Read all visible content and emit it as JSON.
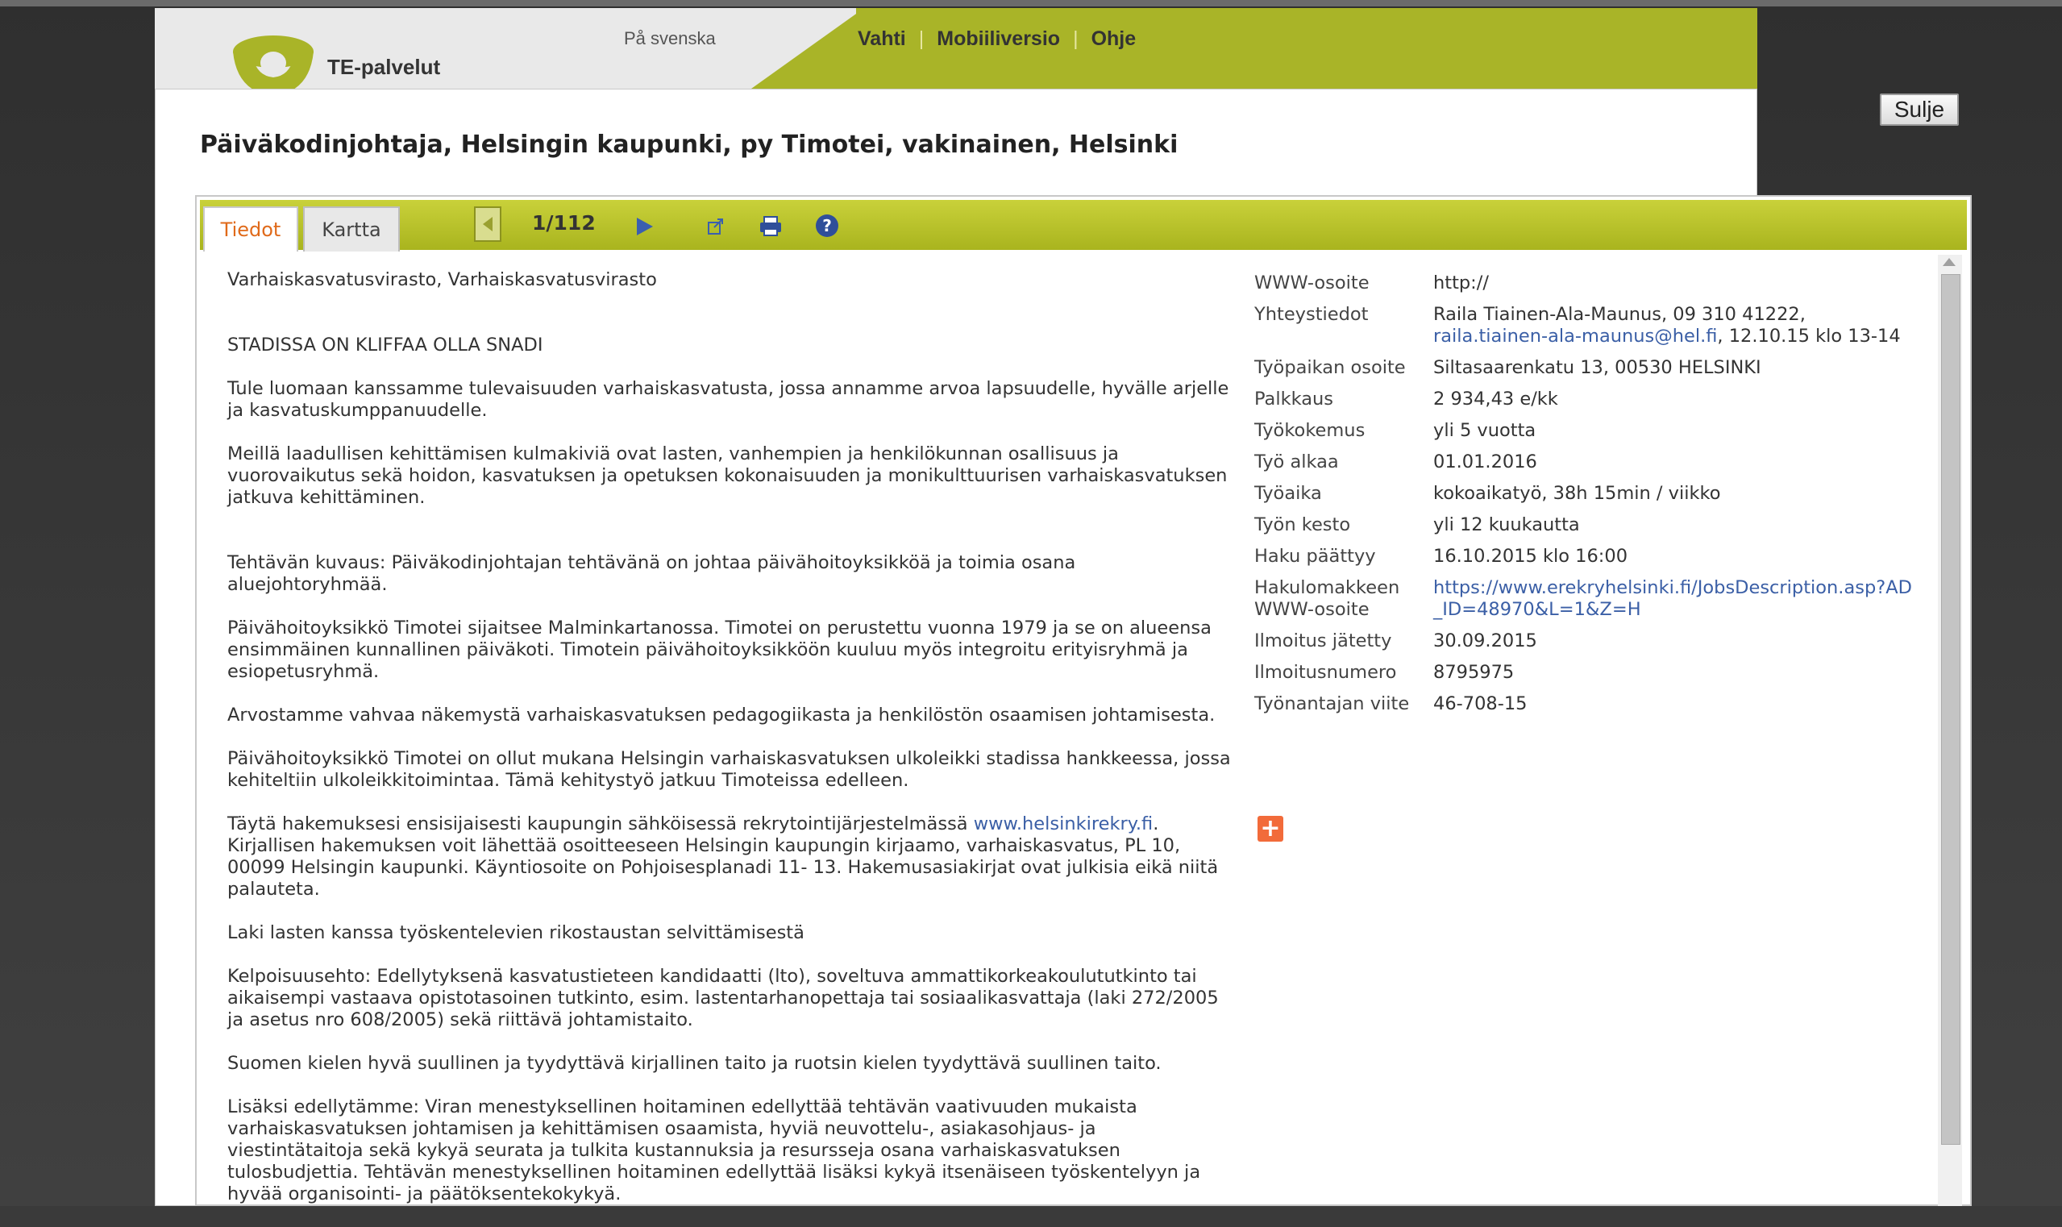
{
  "header": {
    "logo_text": "TE-palvelut",
    "language_link": "På svenska",
    "nav": [
      "Vahti",
      "Mobiiliversio",
      "Ohje"
    ]
  },
  "modal": {
    "close_label": "Sulje",
    "title": "Päiväkodinjohtaja, Helsingin kaupunki, py Timotei, vakinainen, Helsinki"
  },
  "tabs": {
    "info": "Tiedot",
    "map": "Kartta"
  },
  "pager": {
    "count": "1/112"
  },
  "icons": [
    "prev-arrow-icon",
    "next-arrow-icon",
    "external-link-icon",
    "print-icon",
    "help-icon",
    "add-icon"
  ],
  "colors": {
    "header_green": "#a9b428",
    "active_tab": "#e06a1a",
    "link": "#3b5fa6"
  },
  "content": {
    "employer": "Varhaiskasvatusvirasto, Varhaiskasvatusvirasto",
    "slogan": "STADISSA ON KLIFFAA OLLA SNADI",
    "p1": "Tule luomaan kanssamme tulevaisuuden varhaiskasvatusta, jossa annamme arvoa lapsuudelle, hyvälle arjelle ja kasvatuskumppanuudelle.",
    "p2": "Meillä laadullisen kehittämisen kulmakiviä ovat lasten, vanhempien ja henkilökunnan osallisuus ja vuorovaikutus sekä hoidon, kasvatuksen ja opetuksen kokonaisuuden ja monikulttuurisen varhaiskasvatuksen jatkuva kehittäminen.",
    "p3": "Tehtävän kuvaus: Päiväkodinjohtajan tehtävänä on johtaa päivähoitoyksikköä ja toimia osana aluejohtoryhmää.",
    "p4": "Päivähoitoyksikkö Timotei sijaitsee Malminkartanossa. Timotei on perustettu vuonna 1979 ja se on alueensa ensimmäinen kunnallinen päiväkoti. Timotein päivähoitoyksikköön kuuluu myös integroitu erityisryhmä ja esiopetusryhmä.",
    "p5": "Arvostamme vahvaa näkemystä varhaiskasvatuksen pedagogiikasta ja henkilöstön osaamisen johtamisesta.",
    "p6": "Päivähoitoyksikkö Timotei on ollut mukana Helsingin varhaiskasvatuksen ulkoleikki stadissa hankkeessa, jossa kehiteltiin ulkoleikkitoimintaa. Tämä kehitystyö jatkuu Timoteissa edelleen.",
    "p7_before": "Täytä hakemuksesi ensisijaisesti kaupungin sähköisessä rekrytointijärjestelmässä ",
    "p7_link": "www.helsinkirekry.fi",
    "p7_after": ". Kirjallisen hakemuksen voit lähettää osoitteeseen Helsingin kaupungin kirjaamo, varhaiskasvatus, PL 10, 00099 Helsingin kaupunki. Käyntiosoite on Pohjoisesplanadi 11- 13. Hakemusasiakirjat ovat julkisia eikä niitä palauteta.",
    "p8": "Laki lasten kanssa työskentelevien rikostaustan selvittämisestä",
    "p9": "Kelpoisuusehto: Edellytyksenä kasvatustieteen kandidaatti (lto), soveltuva ammattikorkeakoulututkinto tai aikaisempi vastaava opistotasoinen tutkinto, esim. lastentarhanopettaja tai sosiaalikasvattaja (laki 272/2005 ja asetus nro 608/2005) sekä riittävä johtamistaito.",
    "p10": "Suomen kielen hyvä suullinen ja tyydyttävä kirjallinen taito ja ruotsin kielen tyydyttävä suullinen taito.",
    "p11": "Lisäksi edellytämme: Viran menestyksellinen hoitaminen edellyttää tehtävän vaativuuden mukaista varhaiskasvatuksen johtamisen ja kehittämisen osaamista, hyviä neuvottelu-, asiakasohjaus- ja viestintätaitoja sekä kykyä seurata ja tulkita kustannuksia ja resursseja osana varhaiskasvatuksen tulosbudjettia. Tehtävän menestyksellinen hoitaminen edellyttää lisäksi kykyä itsenäiseen työskentelyyn ja hyvää organisointi- ja päätöksentekokykyä."
  },
  "details": {
    "www_label": "WWW-osoite",
    "www_value": "http://",
    "contact_label": "Yhteystiedot",
    "contact_value_1": "Raila Tiainen-Ala-Maunus, 09 310 41222,",
    "contact_email": "raila.tiainen-ala-maunus@hel.fi",
    "contact_value_2": ", 12.10.15 klo 13-14",
    "address_label": "Työpaikan osoite",
    "address_value": "Siltasaarenkatu 13, 00530 HELSINKI",
    "salary_label": "Palkkaus",
    "salary_value": "2 934,43 e/kk",
    "experience_label": "Työkokemus",
    "experience_value": "yli 5 vuotta",
    "start_label": "Työ alkaa",
    "start_value": "01.01.2016",
    "hours_label": "Työaika",
    "hours_value": "kokoaikatyö, 38h 15min / viikko",
    "duration_label": "Työn kesto",
    "duration_value": "yli 12 kuukautta",
    "deadline_label": "Haku päättyy",
    "deadline_value": "16.10.2015 klo 16:00",
    "form_label": "Hakulomakkeen WWW-osoite",
    "form_value": "https://www.erekryhelsinki.fi/JobsDescription.asp?AD_ID=48970&L=1&Z=H",
    "posted_label": "Ilmoitus jätetty",
    "posted_value": "30.09.2015",
    "number_label": "Ilmoitusnumero",
    "number_value": "8795975",
    "ref_label": "Työnantajan viite",
    "ref_value": "46-708-15"
  }
}
